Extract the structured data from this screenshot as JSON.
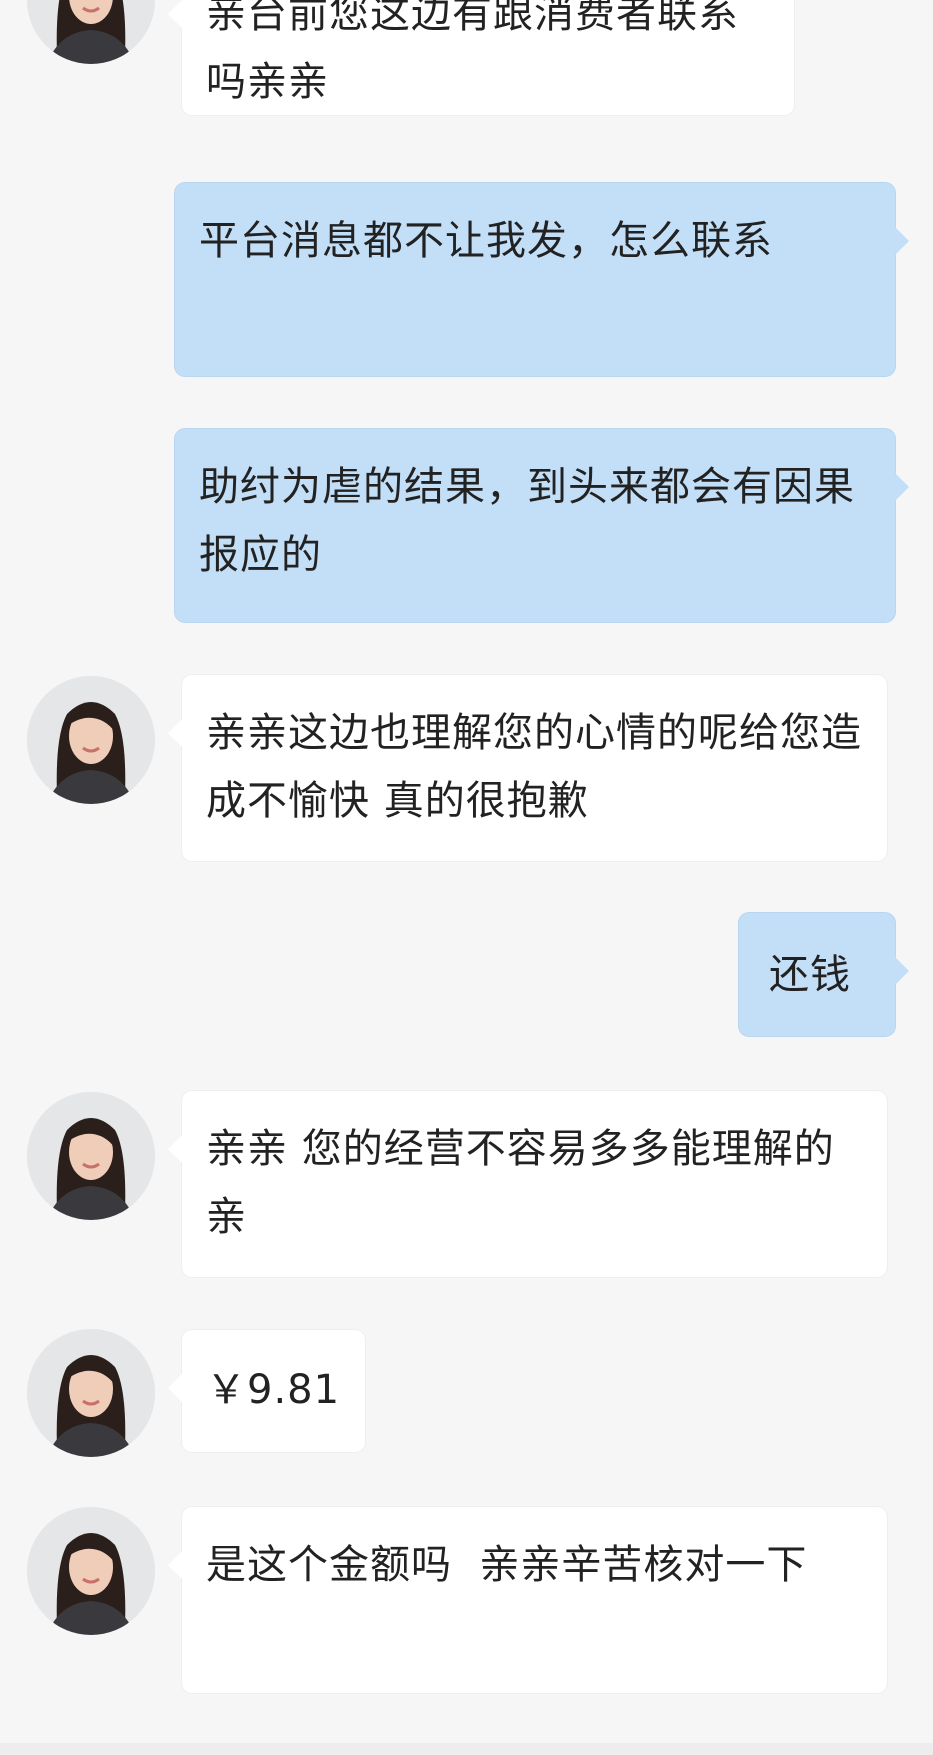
{
  "chat": {
    "messages": [
      {
        "sender": "agent",
        "text": "亲台前您这边有跟消费者联系吗亲亲"
      },
      {
        "sender": "user",
        "text": "平台消息都不让我发，怎么联系"
      },
      {
        "sender": "user",
        "text": "助纣为虐的结果，到头来都会有因果报应的"
      },
      {
        "sender": "agent",
        "text": "亲亲这边也理解您的心情的呢给您造成不愉快 真的很抱歉"
      },
      {
        "sender": "user",
        "text": "还钱"
      },
      {
        "sender": "agent",
        "text": "亲亲 您的经营不容易多多能理解的亲"
      },
      {
        "sender": "agent",
        "text": "￥9.81"
      },
      {
        "sender": "agent",
        "text": "是这个金额吗  亲亲辛苦核对一下"
      }
    ]
  },
  "colors": {
    "background": "#f6f6f6",
    "agent_bubble": "#ffffff",
    "user_bubble": "#c3def7"
  },
  "icons": {
    "agent_avatar": "customer-service-avatar-icon"
  }
}
